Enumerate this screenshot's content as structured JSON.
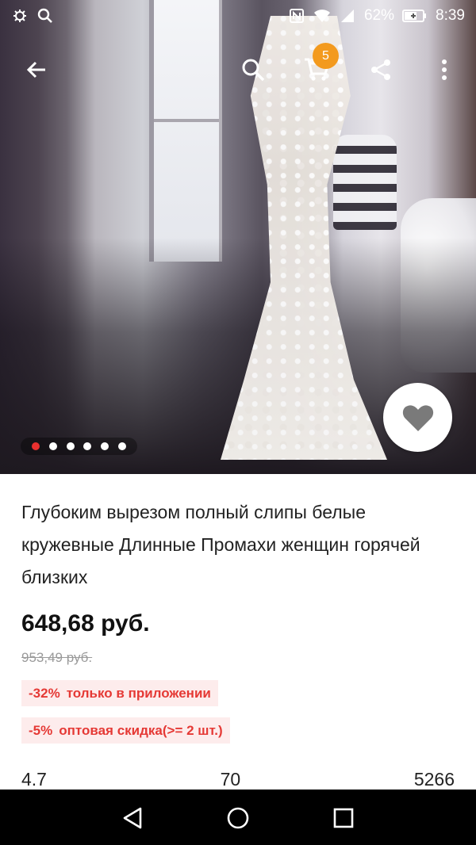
{
  "status_bar": {
    "left_icons": [
      "settings-bug-icon",
      "search-icon"
    ],
    "battery": "62%",
    "time": "8:39",
    "right_icons": [
      "nfc-icon",
      "wifi-icon",
      "signal-icon",
      "battery-icon"
    ]
  },
  "toolbar": {
    "icons": [
      "back-arrow-icon",
      "search-icon",
      "cart-icon",
      "share-icon",
      "more-vert-icon"
    ],
    "cart_count": "5"
  },
  "gallery": {
    "image_count": 6,
    "active_index": 0,
    "favorite_icon": "heart-icon"
  },
  "product": {
    "title": "Глубоким вырезом полный слипы белые кружевные Длинные Промахи женщин горячей близких",
    "price": "648,68 руб.",
    "old_price": "953,49 руб.",
    "promos": [
      {
        "discount": "-32%",
        "text": "только в приложении"
      },
      {
        "discount": "-5%",
        "text": "оптовая скидка(>= 2 шт.)"
      }
    ],
    "stats": {
      "rating": "4.7",
      "reviews": "70",
      "orders": "5266"
    }
  },
  "nav_bar": {
    "icons": [
      "nav-back-icon",
      "nav-home-icon",
      "nav-recents-icon"
    ]
  },
  "colors": {
    "accent": "#e53935",
    "badge": "#f39a1e",
    "promo_bg": "#fdecec",
    "active_dot": "#e9302f"
  }
}
